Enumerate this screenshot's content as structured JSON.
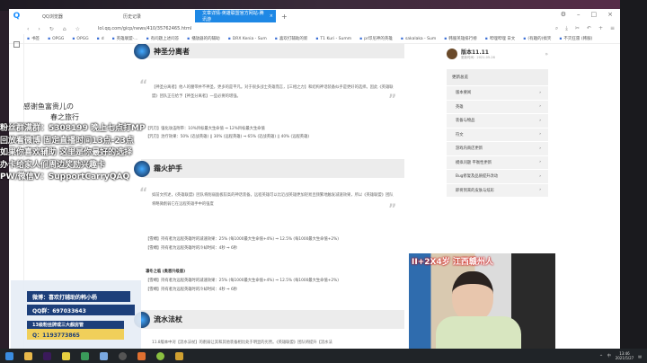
{
  "browser": {
    "tabs": [
      {
        "label": "QQ浏览器"
      },
      {
        "label": "历史记录"
      },
      {
        "label": "文章详情-英雄联盟官方网站-腾讯游"
      }
    ],
    "url": "lol.qq.com/gicp/news/410/35762465.html",
    "bookmarks": [
      "书签",
      "OPGG",
      "OPGG",
      "d",
      "英雄联盟-...",
      "有问题上述问答",
      "播放器的的辅助",
      "DRX Kenia - Sum",
      "喜欢打辅助的新",
      "T1 Kuri - Summ",
      "pr印尼神的英雄",
      "sakalaka - Sum",
      "韩服英雄排行榜",
      "哔哩哔哩 日文",
      "(有趣的)搞笑",
      "不灭狂雷 (韩服)"
    ]
  },
  "article": {
    "sections": [
      {
        "title": "神圣分离者"
      },
      {
        "title": "霜火护手"
      },
      {
        "title": "流水法杖"
      }
    ],
    "quote1": "【神圣分离者】他人的腰带并不神圣，更多的是平凡。对于很多战士英雄而言，【三相之力】和结构神话装备似乎是更好的选择。因此《英雄联盟》团队正在给予【神圣分离者】一些必要的增强。",
    "stats1": [
      "【咒刃】强化攻击附带：10%目标最大生命值 ⇒ 12%目标最大生命值",
      "【咒刃】治疗效果：50% (近战英雄) || 30% (远程英雄) ⇒ 65% (近战英雄) || 40% (远程英雄)"
    ],
    "quote2": "如前文所述，《英雄联盟》团队将削弱面板较高的神话装备。远程英雄可以比近战英雄更加轻易且频繁地触发减速效果，所以《英雄联盟》团队将略微削弱它在远程英雄手中的强度",
    "stats2": [
      "【雪缚】持有者为远程英雄时的减速效果：25% (每1000最大生命值+4%) ⇒ 12.5% (每1000最大生命值+2%)",
      "【雪缚】持有者为远程英雄时的冷却时间：4秒 ⇒ 6秒"
    ],
    "sub": "凛冬之临 (奥恩升级版)",
    "stats3": [
      "【雪缚】持有者为远程英雄时的减速效果：25% (每1000最大生命值+4%) ⇒ 12.5% (每1000最大生命值+2%)",
      "【雪缚】持有者为远程英雄时的冷却时间：4秒 ⇒ 6秒"
    ],
    "quote3": "11.8版本中对【流水法杖】的削弱让其和其他装备相比处于明显的劣势。《英雄联盟》团队将提升【流水法"
  },
  "sidepanel": {
    "version": "版本11.11",
    "date": "更新时间：2021-05-26",
    "heading": "更新总览",
    "items": [
      "版本要闻",
      "英雄",
      "装备与物品",
      "符文",
      "游戏内商店更新",
      "模拟问题 平衡性更新",
      "Bug修复及品质提升改动",
      "即将到来的皮肤与炫彩"
    ]
  },
  "overlay": {
    "thanks1": "感谢鱼富贵儿の",
    "thanks2": "春之旅行",
    "lines": [
      "粉丝群满群：5308199 晚上七点打MP",
      "回放看微博 固定直播时间13点-23点",
      "如果你喜欢辅助 这里是你最好的选择",
      "办卡给家人们周边奖励兴趣卡",
      "PW/微信V：SupportCarryQAQ"
    ]
  },
  "card": {
    "weibo": "微博：喜欢打辅助的韩小杨",
    "qq": "QQ群：697033643",
    "fans": "13级粉丝牌或三大舰房管",
    "q": "Q：1193773865"
  },
  "webcam": {
    "caption": "II+2X4岁 江西赣州人"
  },
  "taskbar": {
    "ime": "中",
    "time": "13:46",
    "date": "2021/5/27"
  }
}
